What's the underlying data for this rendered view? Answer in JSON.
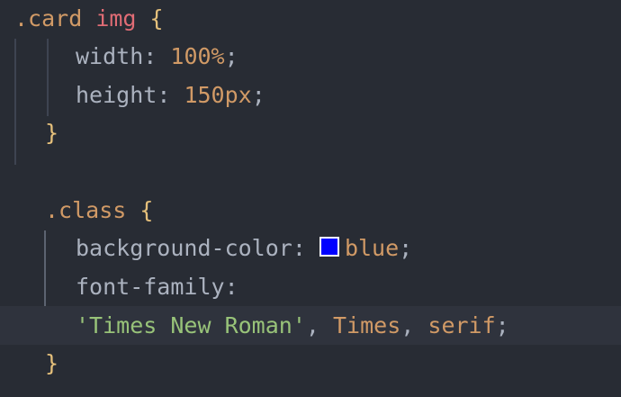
{
  "code": {
    "l1": {
      "selector_class": ".card",
      "selector_tag": "img",
      "brace": "{"
    },
    "l2": {
      "prop": "width",
      "colon": ":",
      "value": "100%",
      "semi": ";"
    },
    "l3": {
      "prop": "height",
      "colon": ":",
      "value": "150px",
      "semi": ";"
    },
    "l4": {
      "brace": "}"
    },
    "l6": {
      "selector": ".class",
      "brace": "{"
    },
    "l7": {
      "prop": "background-color",
      "colon": ":",
      "value": "blue",
      "semi": ";"
    },
    "l8": {
      "prop": "font-family",
      "colon": ":"
    },
    "l9": {
      "string": "'Times New Roman'",
      "comma1": ",",
      "value1": "Times",
      "comma2": ",",
      "value2": "serif",
      "semi": ";"
    },
    "l10": {
      "brace": "}"
    }
  },
  "colors": {
    "background": "#282c34",
    "swatch": "#0000ff"
  }
}
